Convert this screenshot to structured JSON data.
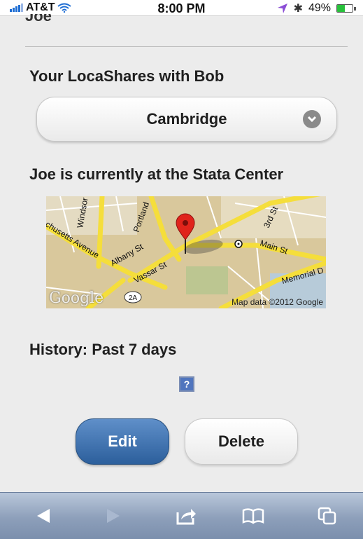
{
  "status_bar": {
    "carrier": "AT&T",
    "time": "8:00 PM",
    "battery_percent": "49%",
    "battery_level": 0.49,
    "icons": [
      "signal-icon",
      "wifi-icon",
      "location-arrow-icon",
      "bluetooth-icon",
      "battery-icon"
    ]
  },
  "previous_section": {
    "title": "Joe"
  },
  "locashares": {
    "heading": "Your LocaShares with Bob",
    "selected_value": "Cambridge"
  },
  "location": {
    "heading": "Joe is currently at the Stata Center",
    "map": {
      "logo_text": "Google",
      "credit": "Map data ©2012 Google",
      "street_labels": [
        "Windsor",
        "Portland",
        "Albany St",
        "chusetts Avenue",
        "Vassar St",
        "3rd St",
        "Main St",
        "Memorial D",
        "2A"
      ]
    }
  },
  "history": {
    "heading": "History: Past 7 days",
    "placeholder_icon": "?"
  },
  "actions": {
    "edit_label": "Edit",
    "delete_label": "Delete"
  },
  "toolbar": {
    "icons": [
      "back-arrow-icon",
      "forward-arrow-icon",
      "share-icon",
      "bookmarks-icon",
      "tabs-icon"
    ]
  },
  "colors": {
    "edit_button": "#3a6db0",
    "battery_fill": "#27c13b",
    "map_pin": "#e0241b"
  }
}
